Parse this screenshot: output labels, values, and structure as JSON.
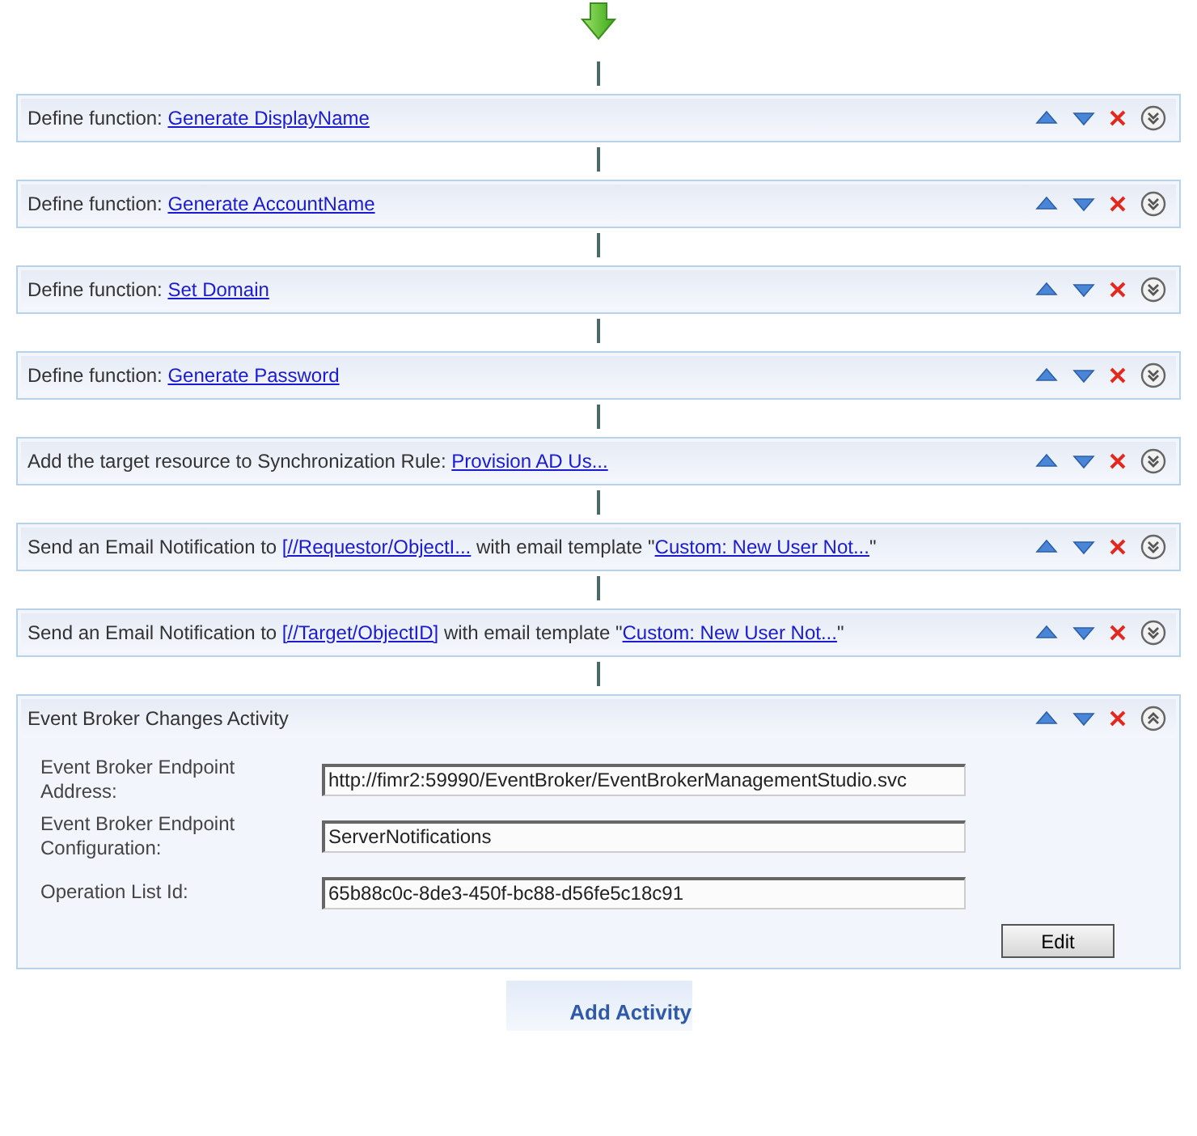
{
  "activities": [
    {
      "expanded": false,
      "title": [
        {
          "kind": "text",
          "text": "Define function: "
        },
        {
          "kind": "link",
          "text": "Generate DisplayName"
        }
      ]
    },
    {
      "expanded": false,
      "title": [
        {
          "kind": "text",
          "text": "Define function: "
        },
        {
          "kind": "link",
          "text": "Generate AccountName"
        }
      ]
    },
    {
      "expanded": false,
      "title": [
        {
          "kind": "text",
          "text": "Define function: "
        },
        {
          "kind": "link",
          "text": "Set Domain"
        }
      ]
    },
    {
      "expanded": false,
      "title": [
        {
          "kind": "text",
          "text": "Define function: "
        },
        {
          "kind": "link",
          "text": "Generate Password"
        }
      ]
    },
    {
      "expanded": false,
      "title": [
        {
          "kind": "text",
          "text": "Add the target resource to Synchronization Rule: "
        },
        {
          "kind": "link",
          "text": "Provision AD Us..."
        }
      ]
    },
    {
      "expanded": false,
      "title": [
        {
          "kind": "text",
          "text": "Send an Email Notification to "
        },
        {
          "kind": "link",
          "text": "[//Requestor/ObjectI..."
        },
        {
          "kind": "text",
          "text": " with email template \""
        },
        {
          "kind": "link",
          "text": "Custom: New User Not..."
        },
        {
          "kind": "text",
          "text": "\""
        }
      ]
    },
    {
      "expanded": false,
      "title": [
        {
          "kind": "text",
          "text": "Send an Email Notification to "
        },
        {
          "kind": "link",
          "text": "[//Target/ObjectID]"
        },
        {
          "kind": "text",
          "text": " with email template \""
        },
        {
          "kind": "link",
          "text": "Custom: New User Not..."
        },
        {
          "kind": "text",
          "text": "\""
        }
      ]
    },
    {
      "expanded": true,
      "title": [
        {
          "kind": "text",
          "text": "Event Broker Changes Activity"
        }
      ],
      "fields": [
        {
          "label": "Event Broker Endpoint Address:",
          "value": "http://fimr2:59990/EventBroker/EventBrokerManagementStudio.svc"
        },
        {
          "label": "Event Broker Endpoint Configuration:",
          "value": "ServerNotifications"
        },
        {
          "label": "Operation List Id:",
          "value": "65b88c0c-8de3-450f-bc88-d56fe5c18c91"
        }
      ],
      "button": "Edit"
    }
  ],
  "add_button": "Add Activity"
}
